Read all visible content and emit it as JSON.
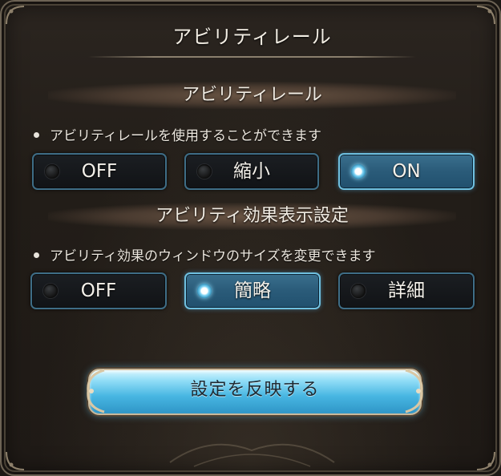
{
  "dialog": {
    "title": "アビリティレール"
  },
  "sections": [
    {
      "header": "アビリティレール",
      "description": "アビリティレールを使用することができます",
      "options": [
        {
          "label": "OFF",
          "selected": false
        },
        {
          "label": "縮小",
          "selected": false
        },
        {
          "label": "ON",
          "selected": true
        }
      ]
    },
    {
      "header": "アビリティ効果表示設定",
      "description": "アビリティ効果のウィンドウのサイズを変更できます",
      "options": [
        {
          "label": "OFF",
          "selected": false
        },
        {
          "label": "簡略",
          "selected": true
        },
        {
          "label": "詳細",
          "selected": false
        }
      ]
    }
  ],
  "apply_button": {
    "label": "設定を反映する"
  },
  "colors": {
    "selected_option": "#2a5b79",
    "unselected_option": "#15181b",
    "option_border": "#3e6d86",
    "apply_button": "#47b6e2"
  },
  "icons": {
    "option_indicator": "radio-dot-icon",
    "corner_ornament": "corner-ornament-icon",
    "button_ornament": "button-ornament-icon"
  }
}
